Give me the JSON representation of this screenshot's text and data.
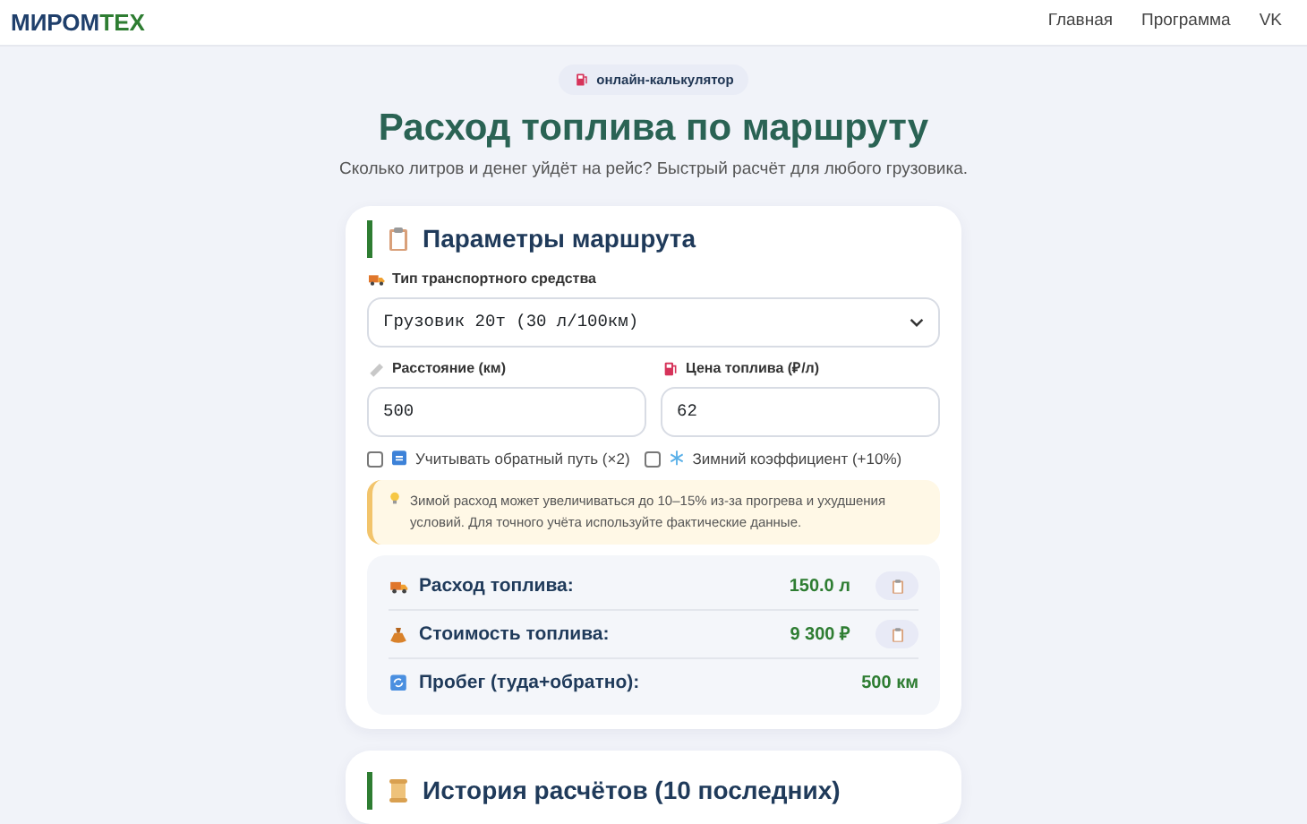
{
  "navbar": {
    "logo": {
      "part_1": "МИРОМ",
      "part_2": "ТЕХ"
    },
    "links": [
      {
        "label": "Главная"
      },
      {
        "label": "Программа"
      },
      {
        "label": "VK"
      }
    ]
  },
  "hero": {
    "badge": "онлайн-калькулятор",
    "title": "Расход топлива по маршруту",
    "subtitle": "Сколько литров и денег уйдёт на рейс? Быстрый расчёт для любого грузовика."
  },
  "params_card": {
    "title": "Параметры маршрута",
    "vehicle": {
      "label": "Тип транспортного средства",
      "value": "Грузовик 20т (30 л/100км)"
    },
    "distance": {
      "label": "Расстояние (км)",
      "value": "500"
    },
    "price": {
      "label": "Цена топлива (₽/л)",
      "value": "62"
    },
    "options": [
      {
        "label": "Учитывать обратный путь (×2)",
        "checked": false
      },
      {
        "label": "Зимний коэффициент (+10%)",
        "checked": false
      }
    ],
    "note": "Зимой расход может увеличиваться до 10–15% из-за прогрева и ухудшения условий. Для точного учёта используйте фактические данные.",
    "results": [
      {
        "label": "Расход топлива:",
        "value": "150.0 л",
        "copyable": true
      },
      {
        "label": "Стоимость топлива:",
        "value": "9 300 ₽",
        "copyable": true
      },
      {
        "label": "Пробег (туда+обратно):",
        "value": "500 км",
        "copyable": false
      }
    ]
  },
  "history_card": {
    "title": "История расчётов (10 последних)"
  }
}
